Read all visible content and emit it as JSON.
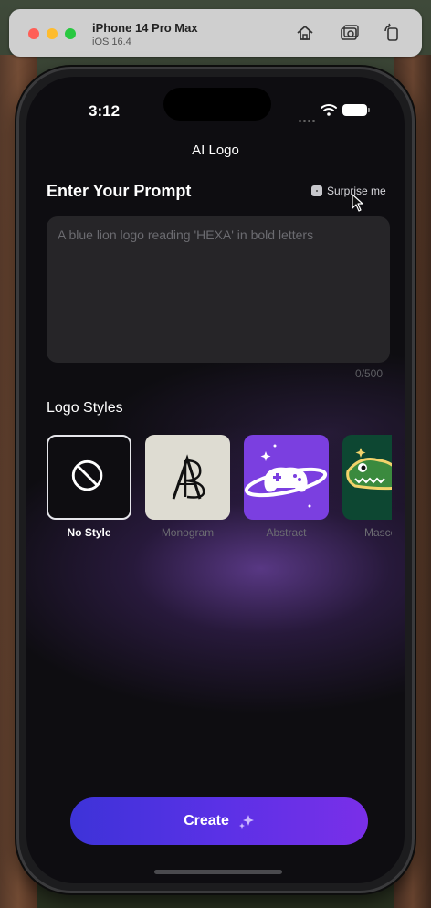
{
  "simulator": {
    "device": "iPhone 14 Pro Max",
    "os": "iOS 16.4"
  },
  "status_bar": {
    "time": "3:12"
  },
  "nav": {
    "title": "AI Logo"
  },
  "prompt": {
    "heading": "Enter Your Prompt",
    "surprise_label": "Surprise me",
    "placeholder": "A blue lion logo reading 'HEXA' in bold letters",
    "value": "",
    "counter": "0/500"
  },
  "styles": {
    "heading": "Logo Styles",
    "items": [
      {
        "label": "No Style",
        "selected": true
      },
      {
        "label": "Monogram",
        "selected": false
      },
      {
        "label": "Abstract",
        "selected": false
      },
      {
        "label": "Mascot",
        "selected": false
      }
    ]
  },
  "create": {
    "label": "Create"
  },
  "colors": {
    "accent_start": "#3d33d8",
    "accent_end": "#7a2fe8",
    "abstract_bg": "#7b3fe0",
    "mascot_bg": "#0d4732"
  },
  "icons": [
    "home-icon",
    "screenshot-icon",
    "rotate-icon",
    "dice-icon",
    "no-style-icon",
    "sparkle-icon"
  ]
}
